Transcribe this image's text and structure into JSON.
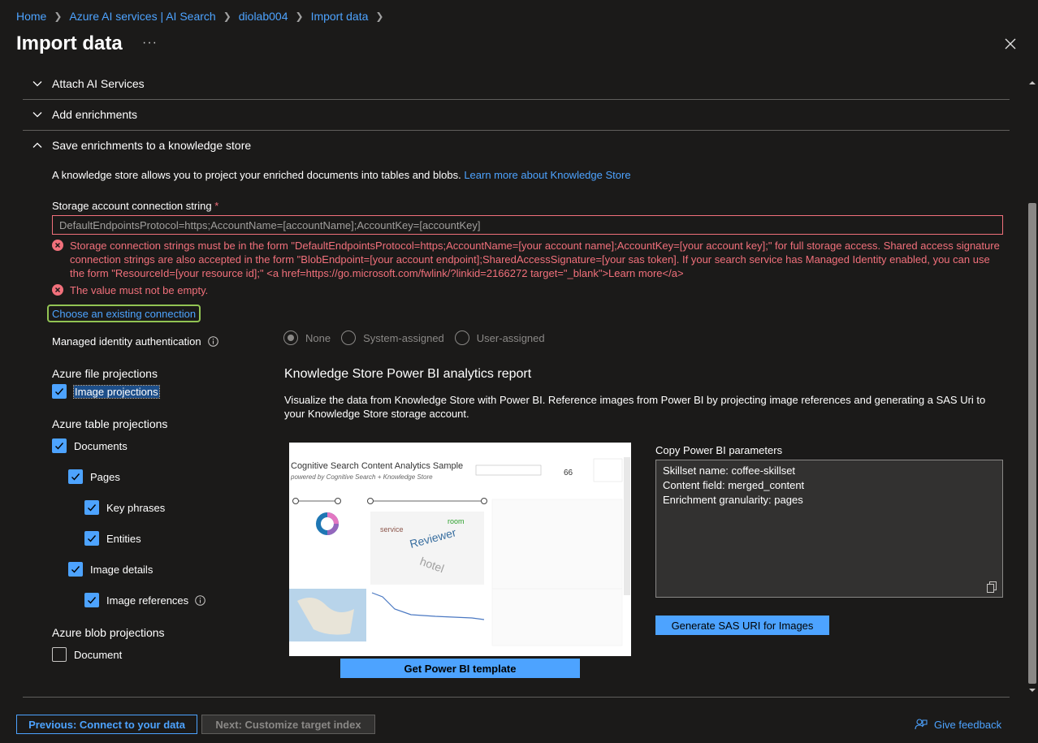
{
  "breadcrumb": {
    "items": [
      "Home",
      "Azure AI services | AI Search",
      "diolab004",
      "Import data"
    ]
  },
  "page": {
    "title": "Import data",
    "more_icon": "ellipsis-icon",
    "close_icon": "close-icon"
  },
  "accordion": {
    "attach_ai": "Attach AI Services",
    "add_enrichments": "Add enrichments",
    "save_knowledge_store": "Save enrichments to a knowledge store"
  },
  "knowledge_store": {
    "intro": "A knowledge store allows you to project your enriched documents into tables and blobs.",
    "learn_more": "Learn more about Knowledge Store",
    "conn_label": "Storage account connection string",
    "required_mark": "*",
    "conn_value": "DefaultEndpointsProtocol=https;AccountName=[accountName];AccountKey=[accountKey]",
    "error_1": "Storage connection strings must be in the form \"DefaultEndpointsProtocol=https;AccountName=[your account name];AccountKey=[your account key];\" for full storage access. Shared access signature connection strings are also accepted in the form \"BlobEndpoint=[your account endpoint];SharedAccessSignature=[your sas token]. If your search service has Managed Identity enabled, you can use the form \"ResourceId=[your resource id];\" <a href=https://go.microsoft.com/fwlink/?linkid=2166272 target=\"_blank\">Learn more</a>",
    "error_2": "The value must not be empty.",
    "choose_existing": "Choose an existing connection",
    "managed_identity_label": "Managed identity authentication",
    "radio_options": [
      "None",
      "System-assigned",
      "User-assigned"
    ],
    "radio_selected": "None"
  },
  "projections": {
    "file_title": "Azure file projections",
    "image_projections": "Image projections",
    "table_title": "Azure table projections",
    "documents": "Documents",
    "pages": "Pages",
    "key_phrases": "Key phrases",
    "entities": "Entities",
    "image_details": "Image details",
    "image_references": "Image references",
    "blob_title": "Azure blob projections",
    "document": "Document"
  },
  "power_bi": {
    "title": "Knowledge Store Power BI analytics report",
    "description": "Visualize the data from Knowledge Store with Power BI. Reference images from Power BI by projecting image references and generating a SAS Uri to your Knowledge Store storage account.",
    "report_title": "Cognitive Search Content Analytics Sample",
    "report_subtitle": "powered by Cognitive Search + Knowledge Store",
    "report_total_docs": "66",
    "get_template": "Get Power BI template",
    "params_label": "Copy Power BI parameters",
    "params": [
      "Skillset name: coffee-skillset",
      "Content field: merged_content",
      "Enrichment granularity: pages"
    ],
    "generate_sas": "Generate SAS URI for Images"
  },
  "footer": {
    "previous": "Previous: Connect to your data",
    "next": "Next: Customize target index",
    "feedback": "Give feedback"
  },
  "colors": {
    "accent": "#4da3ff",
    "error": "#f1707b",
    "background": "#1b1a19"
  }
}
